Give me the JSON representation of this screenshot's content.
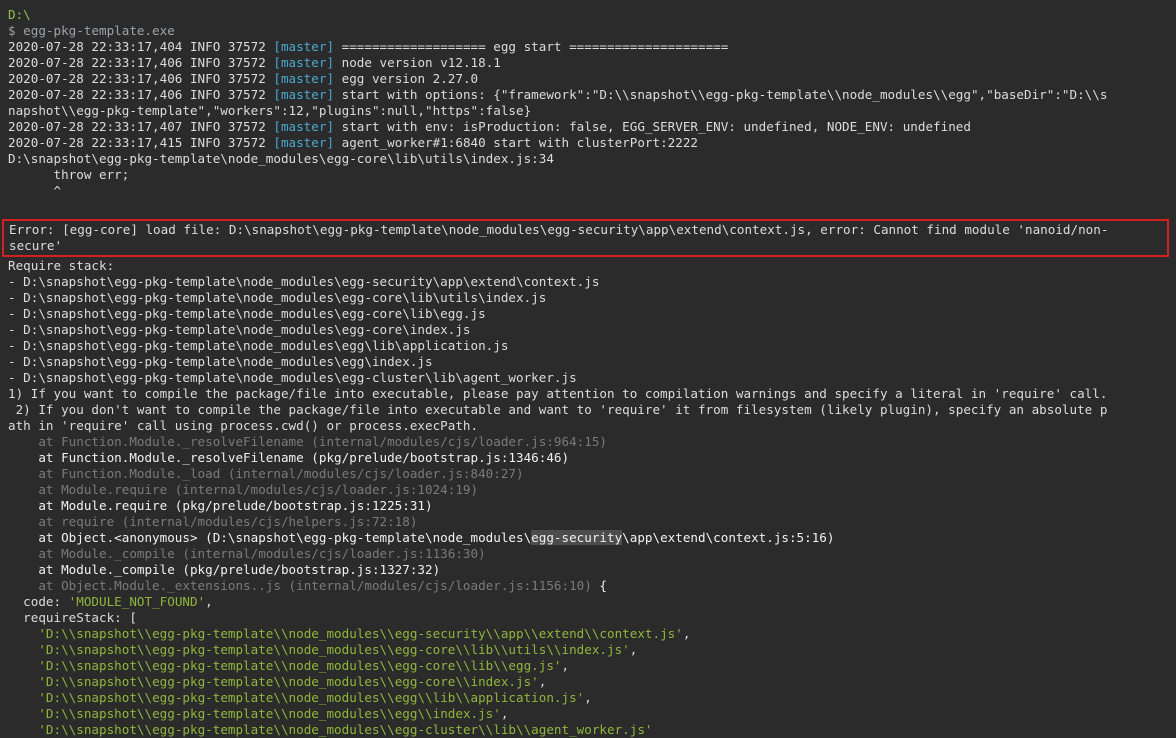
{
  "terminal": {
    "prompt_path": "D:\\",
    "command_line": "$ egg-pkg-template.exe",
    "log_lines": [
      {
        "ts": "2020-07-28 22:33:17,404 INFO 37572 ",
        "tag": "[master]",
        "msg": " =================== egg start ====================="
      },
      {
        "ts": "2020-07-28 22:33:17,406 INFO 37572 ",
        "tag": "[master]",
        "msg": " node version v12.18.1"
      },
      {
        "ts": "2020-07-28 22:33:17,406 INFO 37572 ",
        "tag": "[master]",
        "msg": " egg version 2.27.0"
      },
      {
        "ts": "2020-07-28 22:33:17,406 INFO 37572 ",
        "tag": "[master]",
        "msg": " start with options: {\"framework\":\"D:\\\\snapshot\\\\egg-pkg-template\\\\node_modules\\\\egg\",\"baseDir\":\"D:\\\\s"
      },
      {
        "ts": "",
        "tag": "",
        "msg": "napshot\\\\egg-pkg-template\",\"workers\":12,\"plugins\":null,\"https\":false}"
      },
      {
        "ts": "2020-07-28 22:33:17,407 INFO 37572 ",
        "tag": "[master]",
        "msg": " start with env: isProduction: false, EGG_SERVER_ENV: undefined, NODE_ENV: undefined"
      },
      {
        "ts": "2020-07-28 22:33:17,415 INFO 37572 ",
        "tag": "[master]",
        "msg": " agent_worker#1:6840 start with clusterPort:2222"
      }
    ],
    "trace_head": [
      "D:\\snapshot\\egg-pkg-template\\node_modules\\egg-core\\lib\\utils\\index.js:34",
      "      throw err;",
      "      ^"
    ],
    "error_lines": [
      "Error: [egg-core] load file: D:\\snapshot\\egg-pkg-template\\node_modules\\egg-security\\app\\extend\\context.js, error: Cannot find module 'nanoid/non-",
      "secure'"
    ],
    "require_stack_title": "Require stack:",
    "require_stack": [
      "- D:\\snapshot\\egg-pkg-template\\node_modules\\egg-security\\app\\extend\\context.js",
      "- D:\\snapshot\\egg-pkg-template\\node_modules\\egg-core\\lib\\utils\\index.js",
      "- D:\\snapshot\\egg-pkg-template\\node_modules\\egg-core\\lib\\egg.js",
      "- D:\\snapshot\\egg-pkg-template\\node_modules\\egg-core\\index.js",
      "- D:\\snapshot\\egg-pkg-template\\node_modules\\egg\\lib\\application.js",
      "- D:\\snapshot\\egg-pkg-template\\node_modules\\egg\\index.js",
      "- D:\\snapshot\\egg-pkg-template\\node_modules\\egg-cluster\\lib\\agent_worker.js"
    ],
    "hints": [
      "1) If you want to compile the package/file into executable, please pay attention to compilation warnings and specify a literal in 'require' call.",
      " 2) If you don't want to compile the package/file into executable and want to 'require' it from filesystem (likely plugin), specify an absolute p",
      "ath in 'require' call using process.cwd() or process.execPath."
    ],
    "frames": [
      {
        "text": "    at Function.Module._resolveFilename (internal/modules/cjs/loader.js:964:15)",
        "style": "gray"
      },
      {
        "text": "    at Function.Module._resolveFilename (pkg/prelude/bootstrap.js:1346:46)",
        "style": "bright"
      },
      {
        "text": "    at Function.Module._load (internal/modules/cjs/loader.js:840:27)",
        "style": "gray"
      },
      {
        "text": "    at Module.require (internal/modules/cjs/loader.js:1024:19)",
        "style": "gray"
      },
      {
        "text": "    at Module.require (pkg/prelude/bootstrap.js:1225:31)",
        "style": "bright"
      },
      {
        "text": "    at require (internal/modules/cjs/helpers.js:72:18)",
        "style": "gray"
      }
    ],
    "anon_frame": {
      "before": "    at Object.<anonymous> (D:\\snapshot\\egg-pkg-template\\node_modules\\",
      "highlight": "egg-security",
      "after": "\\app\\extend\\context.js:5:16)"
    },
    "frames2": [
      {
        "text": "    at Module._compile (internal/modules/cjs/loader.js:1136:30)",
        "style": "gray"
      },
      {
        "text": "    at Module._compile (pkg/prelude/bootstrap.js:1327:32)",
        "style": "bright"
      }
    ],
    "last_frame": {
      "text": "    at Object.Module._extensions..js (internal/modules/cjs/loader.js:1156:10)",
      "suffix": " {"
    },
    "code_label": "  code: ",
    "code_value": "'MODULE_NOT_FOUND'",
    "code_suffix": ",",
    "require_stack_label": "  requireStack: [",
    "require_stack_strings": [
      "'D:\\\\snapshot\\\\egg-pkg-template\\\\node_modules\\\\egg-security\\\\app\\\\extend\\\\context.js'",
      "'D:\\\\snapshot\\\\egg-pkg-template\\\\node_modules\\\\egg-core\\\\lib\\\\utils\\\\index.js'",
      "'D:\\\\snapshot\\\\egg-pkg-template\\\\node_modules\\\\egg-core\\\\lib\\\\egg.js'",
      "'D:\\\\snapshot\\\\egg-pkg-template\\\\node_modules\\\\egg-core\\\\index.js'",
      "'D:\\\\snapshot\\\\egg-pkg-template\\\\node_modules\\\\egg\\\\lib\\\\application.js'",
      "'D:\\\\snapshot\\\\egg-pkg-template\\\\node_modules\\\\egg\\\\index.js'",
      "'D:\\\\snapshot\\\\egg-pkg-template\\\\node_modules\\\\egg-cluster\\\\lib\\\\agent_worker.js'"
    ],
    "colors": {
      "background": "#2b2b2b",
      "path_green": "#8fc24a",
      "master_tag": "#49a9ce",
      "error_border": "#d42020",
      "string_green": "#8fb63c"
    }
  }
}
